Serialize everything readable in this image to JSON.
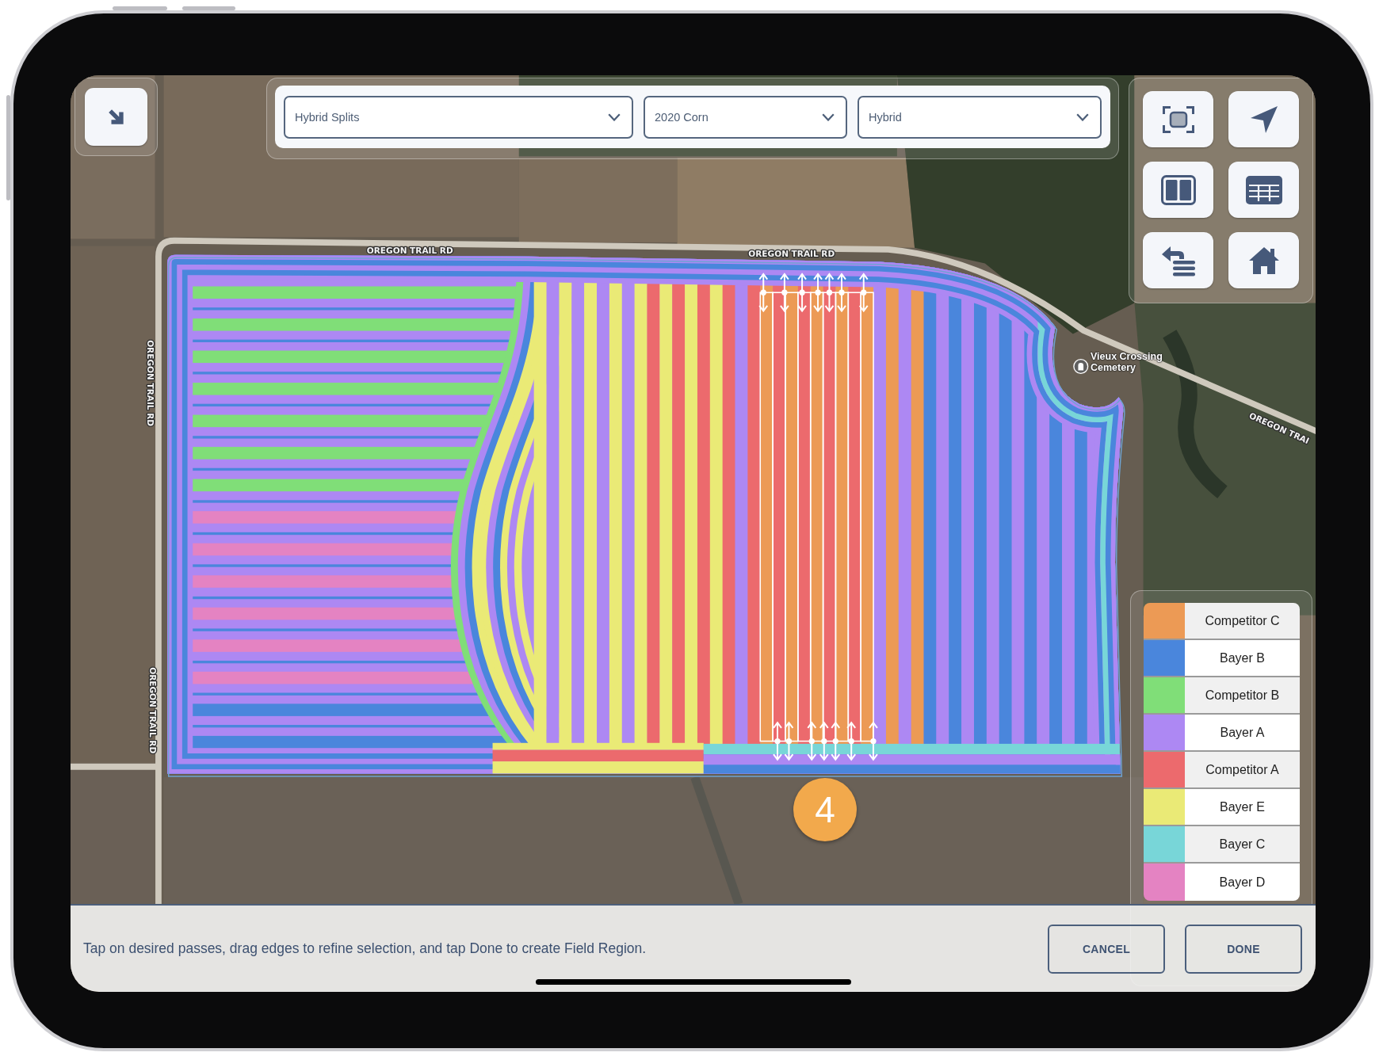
{
  "filters": [
    {
      "value": "Hybrid Splits"
    },
    {
      "value": "2020 Corn"
    },
    {
      "value": "Hybrid"
    }
  ],
  "map": {
    "road_labels": [
      "OREGON TRAIL RD",
      "OREGON TRAIL RD",
      "OREGON TRAIL RD",
      "OREGON TRAIL RD",
      "OREGON TRAI"
    ],
    "place": "Vieux Crossing Cemetery",
    "step_badge": "4"
  },
  "legend": [
    {
      "name": "Competitor C",
      "color": "#ec9a55"
    },
    {
      "name": "Bayer B",
      "color": "#4a86dc"
    },
    {
      "name": "Competitor B",
      "color": "#80de78"
    },
    {
      "name": "Bayer A",
      "color": "#ad88f3"
    },
    {
      "name": "Competitor A",
      "color": "#ec6a6d"
    },
    {
      "name": "Bayer E",
      "color": "#eaea76"
    },
    {
      "name": "Bayer C",
      "color": "#78d6d8"
    },
    {
      "name": "Bayer D",
      "color": "#e483c2"
    }
  ],
  "instruction": "Tap on desired passes, drag edges to refine selection, and tap Done to create Field Region.",
  "buttons": [
    "CANCEL",
    "DONE"
  ]
}
